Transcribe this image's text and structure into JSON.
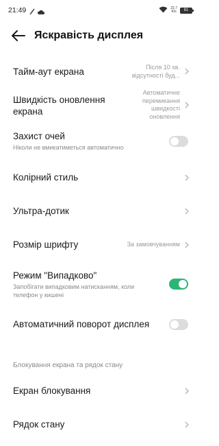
{
  "status_bar": {
    "time": "21:49",
    "net_speed_value": "22,7",
    "net_speed_unit": "K/s",
    "battery": "81"
  },
  "header": {
    "title": "Яскравість дисплея"
  },
  "rows": {
    "timeout": {
      "title": "Тайм-аут екрана",
      "value_line1": "Після 10 хв.",
      "value_line2": "відсутності буд..."
    },
    "refresh": {
      "title_line1": "Швидкість оновлення",
      "title_line2": "екрана",
      "value_line1": "Автоматичне",
      "value_line2": "перемикання",
      "value_line3": "швидкості",
      "value_line4": "оновлення"
    },
    "eye": {
      "title": "Захист очей",
      "subtitle": "Ніколи не вмикатиметься автоматично",
      "enabled": false
    },
    "color_style": {
      "title": "Колірний стиль"
    },
    "ultra_touch": {
      "title": "Ультра-дотик"
    },
    "font_size": {
      "title": "Розмір шрифту",
      "value": "За замовчуванням"
    },
    "pocket_mode": {
      "title": "Режим \"Випадково\"",
      "subtitle_line1": "Запобігати випадковим натисканням, коли",
      "subtitle_line2": "телефон у кишені",
      "enabled": true
    },
    "auto_rotate": {
      "title": "Автоматичний поворот дисплея",
      "enabled": false
    },
    "lock_screen": {
      "title": "Екран блокування"
    },
    "status_bar_row": {
      "title": "Рядок стану"
    }
  },
  "section": {
    "lock_and_status": "Блокування екрана та рядок стану"
  },
  "colors": {
    "accent_on": "#2bb673",
    "toggle_off": "#dcdcdc"
  }
}
